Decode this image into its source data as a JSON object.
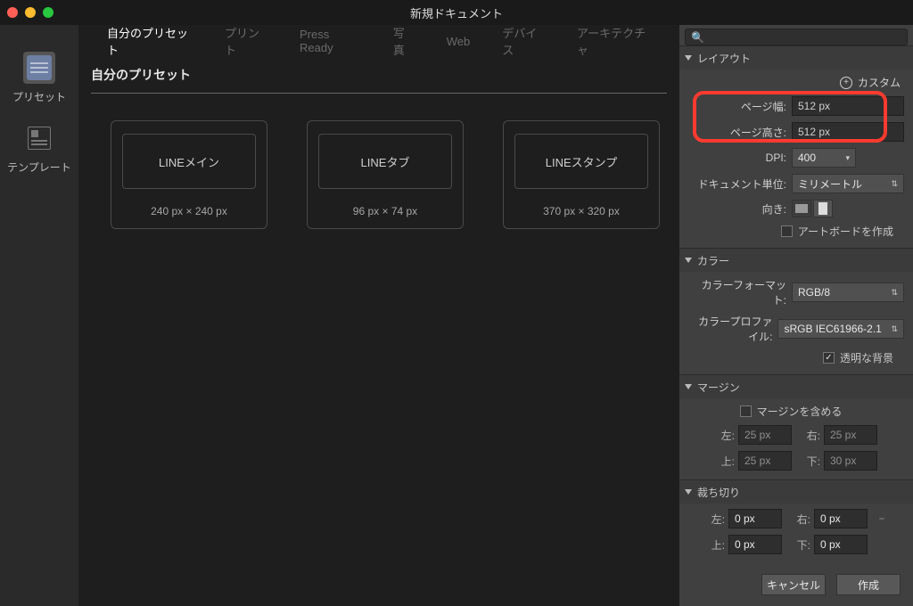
{
  "window": {
    "title": "新規ドキュメント"
  },
  "rail": {
    "presets": "プリセット",
    "templates": "テンプレート"
  },
  "tabs": {
    "items": [
      "自分のプリセット",
      "プリント",
      "Press Ready",
      "写真",
      "Web",
      "デバイス",
      "アーキテクチャ"
    ],
    "activeIndex": 0
  },
  "section": {
    "title": "自分のプリセット"
  },
  "cards": [
    {
      "name": "LINEメイン",
      "dims": "240 px × 240 px"
    },
    {
      "name": "LINEタブ",
      "dims": "96 px × 74 px"
    },
    {
      "name": "LINEスタンプ",
      "dims": "370 px × 320 px"
    }
  ],
  "layout": {
    "heading": "レイアウト",
    "custom": "カスタム",
    "pageWidthLabel": "ページ幅:",
    "pageWidthValue": "512 px",
    "pageHeightLabel": "ページ高さ:",
    "pageHeightValue": "512 px",
    "dpiLabel": "DPI:",
    "dpiValue": "400",
    "unitsLabel": "ドキュメント単位:",
    "unitsValue": "ミリメートル",
    "orientLabel": "向き:",
    "artboardLabel": "アートボードを作成"
  },
  "color": {
    "heading": "カラー",
    "formatLabel": "カラーフォーマット:",
    "formatValue": "RGB/8",
    "profileLabel": "カラープロファイル:",
    "profileValue": "sRGB IEC61966-2.1",
    "transparentLabel": "透明な背景",
    "transparentChecked": true
  },
  "margin": {
    "heading": "マージン",
    "includeLabel": "マージンを含める",
    "left": "25 px",
    "right": "25 px",
    "top": "25 px",
    "bottom": "30 px",
    "lblLeft": "左:",
    "lblRight": "右:",
    "lblTop": "上:",
    "lblBottom": "下:"
  },
  "bleed": {
    "heading": "裁ち切り",
    "left": "0 px",
    "right": "0 px",
    "top": "0 px",
    "bottom": "0 px",
    "lblLeft": "左:",
    "lblRight": "右:",
    "lblTop": "上:",
    "lblBottom": "下:"
  },
  "footer": {
    "cancel": "キャンセル",
    "create": "作成"
  }
}
